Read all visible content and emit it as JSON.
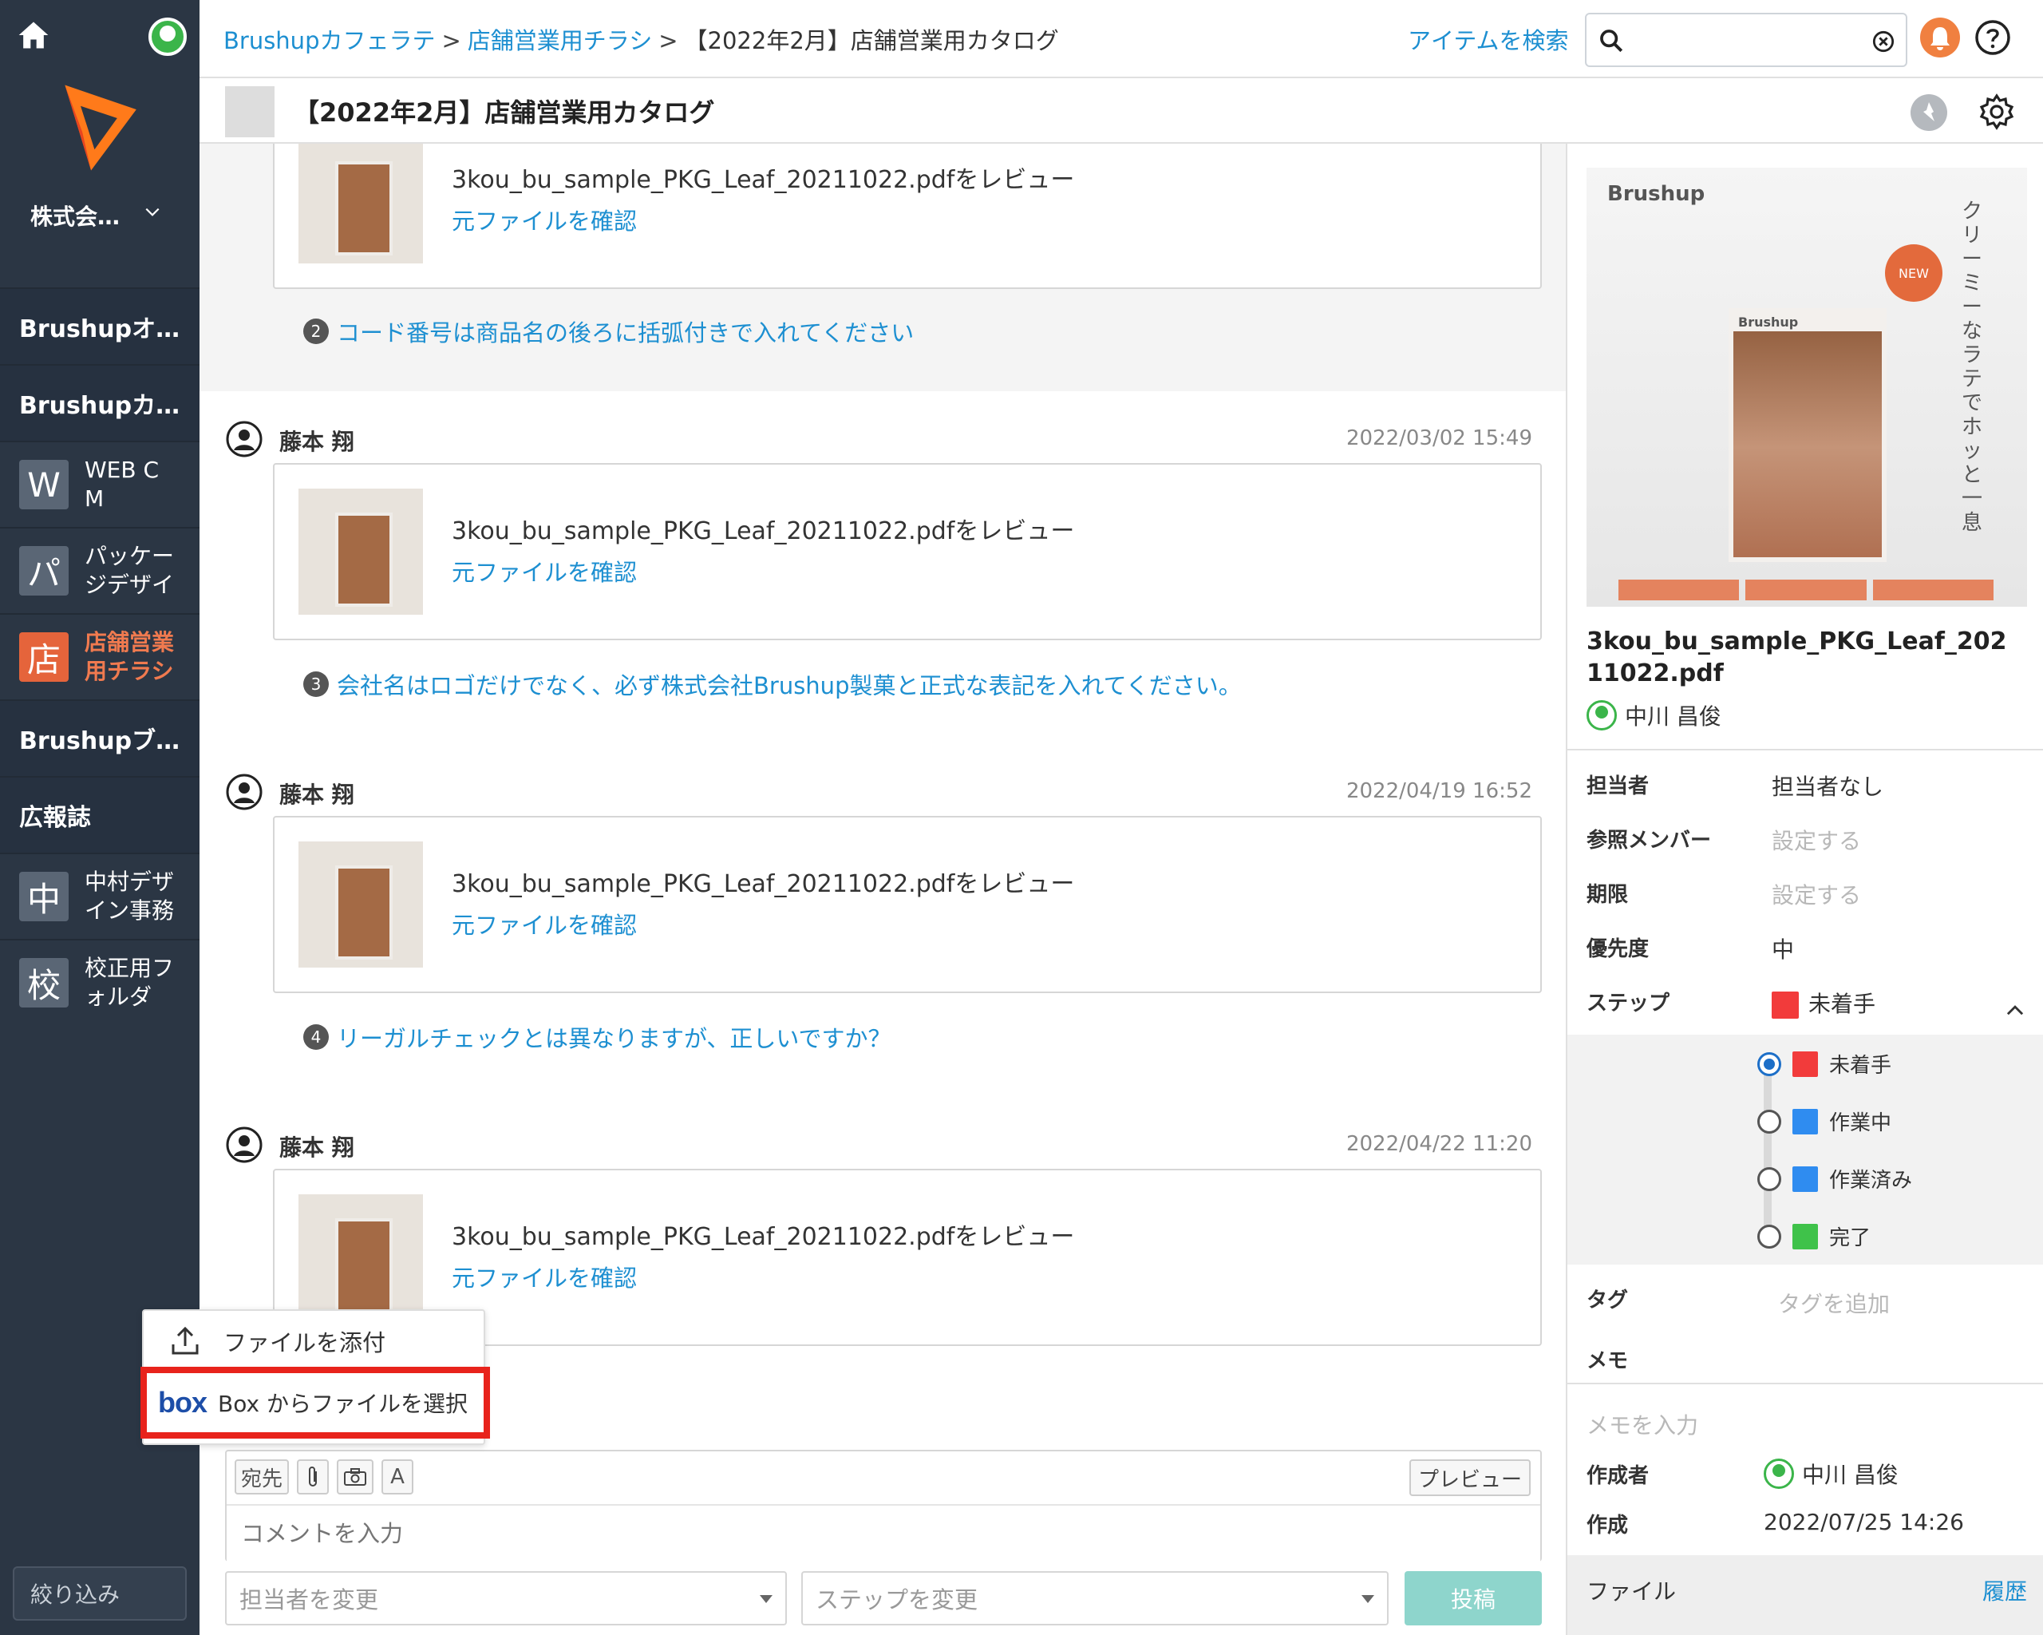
{
  "sidebar": {
    "org_name": "株式会…",
    "groups": [
      {
        "label": "Brushupオ…"
      },
      {
        "label": "Brushupカ…"
      }
    ],
    "items": [
      {
        "badge": "W",
        "label": "WEB C M"
      },
      {
        "badge": "パ",
        "label": "パッケー ジデザイ"
      },
      {
        "badge": "店",
        "label": "店舗営業 用チラシ"
      }
    ],
    "groups2": [
      {
        "label": "Brushupブ…"
      },
      {
        "label": "広報誌"
      }
    ],
    "items2": [
      {
        "badge": "中",
        "label": "中村デザ イン事務"
      },
      {
        "badge": "校",
        "label": "校正用フ ォルダ"
      }
    ],
    "filter_label": "絞り込み"
  },
  "header": {
    "breadcrumb": [
      "Brushupカフェラテ",
      "店舗営業用チラシ",
      "【2022年2月】店舗営業用カタログ"
    ],
    "breadcrumb_sep": ">",
    "search_link": "アイテムを検索",
    "search_value": ""
  },
  "title": "【2022年2月】店舗営業用カタログ",
  "comments": [
    {
      "card_text": "3kou_bu_sample_PKG_Leaf_20211022.pdfをレビュー",
      "card_link": "元ファイルを確認",
      "note_num": "2",
      "note": "コード番号は商品名の後ろに括弧付きで入れてください"
    },
    {
      "author": "藤本 翔",
      "date": "2022/03/02 15:49",
      "card_text": "3kou_bu_sample_PKG_Leaf_20211022.pdfをレビュー",
      "card_link": "元ファイルを確認",
      "note_num": "3",
      "note": "会社名はロゴだけでなく、必ず株式会社Brushup製菓と正式な表記を入れてください。"
    },
    {
      "author": "藤本 翔",
      "date": "2022/04/19 16:52",
      "card_text": "3kou_bu_sample_PKG_Leaf_20211022.pdfをレビュー",
      "card_link": "元ファイルを確認",
      "note_num": "4",
      "note": "リーガルチェックとは異なりますが、正しいですか？"
    },
    {
      "author": "藤本 翔",
      "date": "2022/04/22 11:20",
      "card_text": "3kou_bu_sample_PKG_Leaf_20211022.pdfをレビュー",
      "card_link": "元ファイルを確認"
    }
  ],
  "attach_menu": {
    "attach_label": "ファイルを添付",
    "box_logo": "box",
    "box_label": "Box からファイルを選択"
  },
  "composer": {
    "tool_to": "宛先",
    "tool_font": "A",
    "preview": "プレビュー",
    "placeholder": "コメントを入力",
    "assignee_select": "担当者を変更",
    "step_select": "ステップを変更",
    "post": "投稿"
  },
  "right_panel": {
    "preview": {
      "brand": "Brushup",
      "pack_brand": "Brushup",
      "new_badge": "NEW",
      "vertical_text": "クリーミーなラテでホッと一息"
    },
    "file_name": "3kou_bu_sample_PKG_Leaf_20211022.pdf",
    "uploader": "中川 昌俊",
    "props": [
      {
        "label": "担当者",
        "value": "担当者なし"
      },
      {
        "label": "参照メンバー",
        "value": "設定する"
      },
      {
        "label": "期限",
        "value": "設定する"
      },
      {
        "label": "優先度",
        "value": "中"
      },
      {
        "label": "ステップ",
        "value": "未着手"
      }
    ],
    "steps": [
      {
        "label": "未着手",
        "color": "#f23b3b",
        "selected": true
      },
      {
        "label": "作業中",
        "color": "#2f8cf0",
        "selected": false
      },
      {
        "label": "作業済み",
        "color": "#2f8cf0",
        "selected": false
      },
      {
        "label": "完了",
        "color": "#3fc24a",
        "selected": false
      }
    ],
    "tag_label": "タグ",
    "tag_add": "タグを追加",
    "memo_label": "メモ",
    "memo_placeholder": "メモを入力",
    "creator_label": "作成者",
    "creator": "中川 昌俊",
    "created_label": "作成",
    "created": "2022/07/25 14:26",
    "files_label": "ファイル",
    "history_link": "履歴"
  },
  "colors": {
    "sidebar": "#2b3644",
    "accent": "#1d8fd1",
    "highlight": "#e8231c",
    "active": "#e5643b"
  }
}
